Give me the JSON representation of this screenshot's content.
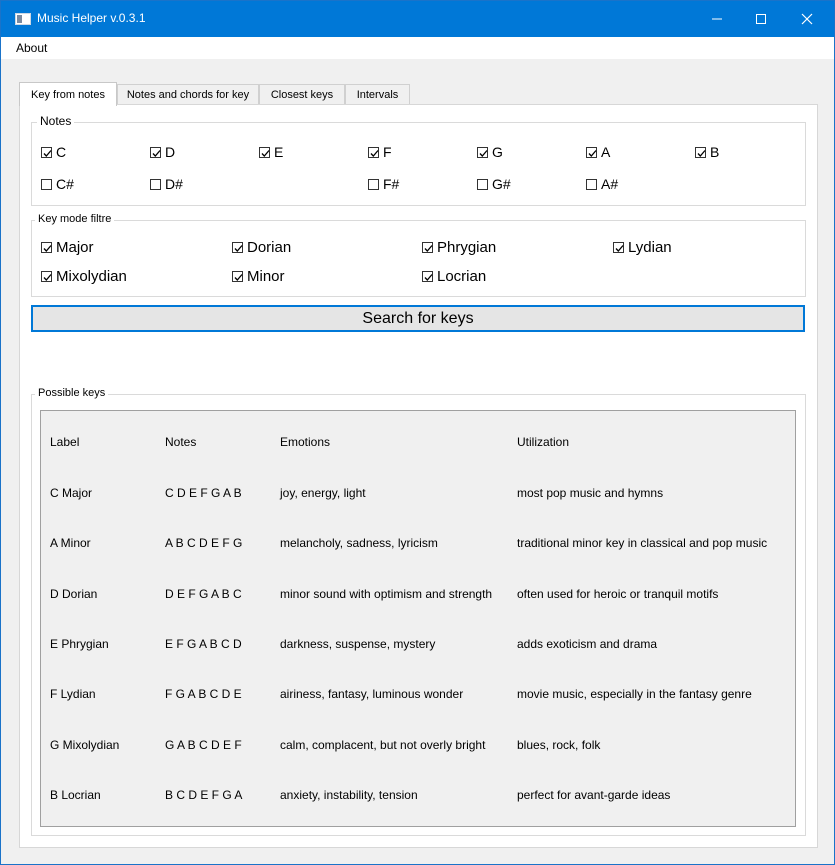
{
  "window": {
    "title": "Music Helper v.0.3.1"
  },
  "menu": {
    "about": "About"
  },
  "tabs": [
    {
      "label": "Key from notes",
      "active": true
    },
    {
      "label": "Notes and chords for key",
      "active": false
    },
    {
      "label": "Closest keys",
      "active": false
    },
    {
      "label": "Intervals",
      "active": false
    }
  ],
  "notes_group": {
    "title": "Notes",
    "notes": [
      {
        "label": "C",
        "checked": true
      },
      {
        "label": "D",
        "checked": true
      },
      {
        "label": "E",
        "checked": true
      },
      {
        "label": "F",
        "checked": true
      },
      {
        "label": "G",
        "checked": true
      },
      {
        "label": "A",
        "checked": true
      },
      {
        "label": "B",
        "checked": true
      },
      {
        "label": "C#",
        "checked": false
      },
      {
        "label": "D#",
        "checked": false
      },
      {
        "label": "F#",
        "checked": false
      },
      {
        "label": "G#",
        "checked": false
      },
      {
        "label": "A#",
        "checked": false
      }
    ]
  },
  "mode_group": {
    "title": "Key mode filtre",
    "modes": [
      {
        "label": "Major",
        "checked": true
      },
      {
        "label": "Dorian",
        "checked": true
      },
      {
        "label": "Phrygian",
        "checked": true
      },
      {
        "label": "Lydian",
        "checked": true
      },
      {
        "label": "Mixolydian",
        "checked": true
      },
      {
        "label": "Minor",
        "checked": true
      },
      {
        "label": "Locrian",
        "checked": true
      }
    ]
  },
  "search_button": "Search for keys",
  "results": {
    "title": "Possible keys",
    "headers": [
      "Label",
      "Notes",
      "Emotions",
      "Utilization"
    ],
    "rows": [
      [
        "C Major",
        "C D E F G A B",
        "joy, energy, light",
        "most pop music and hymns"
      ],
      [
        "A Minor",
        "A B C D E F G",
        "melancholy, sadness, lyricism",
        "traditional minor key in classical and pop music"
      ],
      [
        "D Dorian",
        "D E F G A B C",
        "minor sound with optimism and strength",
        "often used for heroic or tranquil motifs"
      ],
      [
        "E Phrygian",
        "E F G A B C D",
        "darkness, suspense, mystery",
        "adds exoticism and drama"
      ],
      [
        "F Lydian",
        "F G A B C D E",
        "airiness, fantasy, luminous wonder",
        "movie music, especially in the fantasy genre"
      ],
      [
        "G Mixolydian",
        "G A B C D E F",
        "calm, complacent, but not overly bright",
        "blues, rock, folk"
      ],
      [
        "B Locrian",
        "B C D E F G A",
        "anxiety, instability, tension",
        "perfect for avant-garde ideas"
      ]
    ]
  },
  "colors": {
    "titlebar": "#0078d7",
    "accent": "#0078d7",
    "background": "#f0f0f0"
  },
  "icons": [
    "app-icon",
    "minimize-icon",
    "maximize-icon",
    "close-icon",
    "checkmark-icon"
  ]
}
